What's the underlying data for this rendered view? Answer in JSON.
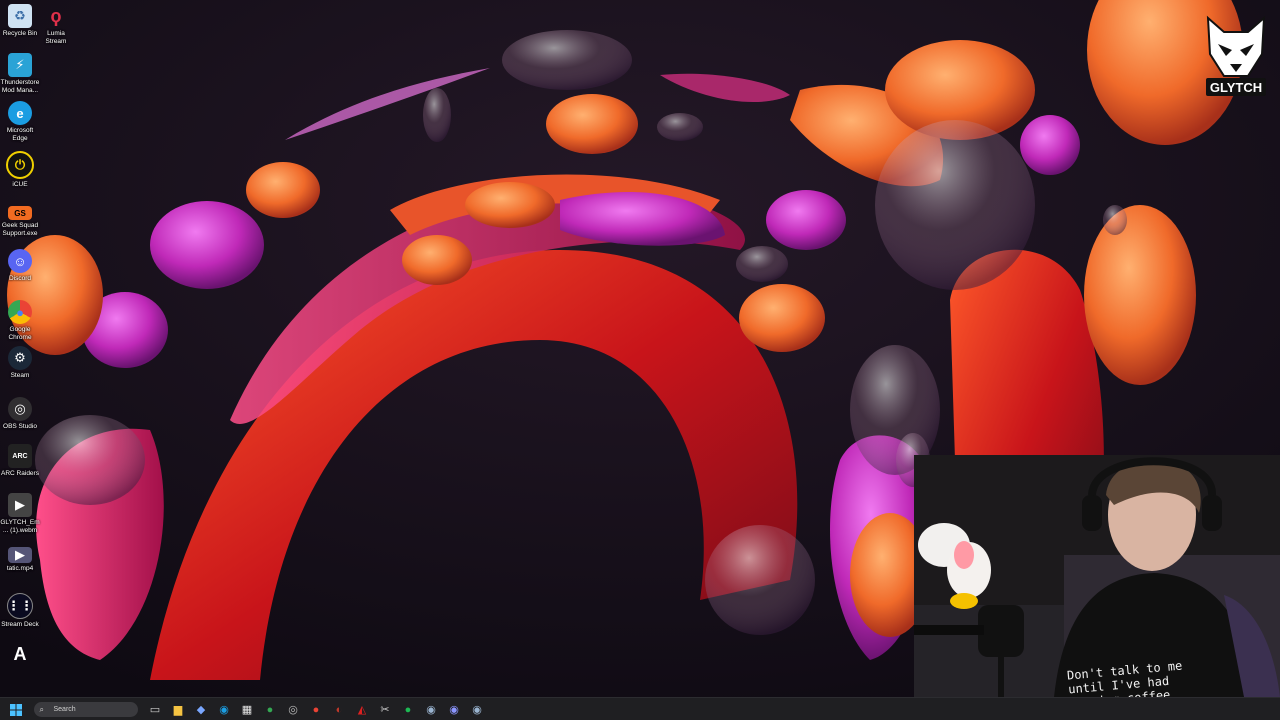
{
  "desktop": {
    "icons": [
      {
        "label": "Recycle Bin",
        "icon": "recycle-bin-icon",
        "color": "#6fa8dc"
      },
      {
        "label": "Lumia Stream",
        "icon": "lumia-stream-icon",
        "color": "#e0304a"
      },
      {
        "label": "Thunderstore Mod Mana...",
        "icon": "thunderstore-icon",
        "color": "#2aa3d6"
      },
      {
        "label": "Microsoft Edge",
        "icon": "edge-icon",
        "color": "#1b9de2"
      },
      {
        "label": "iCUE",
        "icon": "icue-icon",
        "color": "#f0d000"
      },
      {
        "label": "Geek Squad Support.exe",
        "icon": "geek-squad-icon",
        "color": "#f26b21"
      },
      {
        "label": "Discord",
        "icon": "discord-icon",
        "color": "#5865f2"
      },
      {
        "label": "Google Chrome",
        "icon": "chrome-icon",
        "color": "#34a853"
      },
      {
        "label": "Steam",
        "icon": "steam-icon",
        "color": "#1b2838"
      },
      {
        "label": "OBS Studio",
        "icon": "obs-icon",
        "color": "#302e31"
      },
      {
        "label": "ARC Raiders",
        "icon": "arc-raiders-icon",
        "color": "#222222"
      },
      {
        "label": "GLYTCH_Em... (1).webm",
        "icon": "video-file-icon",
        "color": "#444444"
      },
      {
        "label": "tatic.mp4",
        "icon": "video-file-icon",
        "color": "#555577"
      },
      {
        "label": "Stream Deck",
        "icon": "stream-deck-icon",
        "color": "#0a0a20"
      },
      {
        "label": "Adobe",
        "icon": "adobe-icon",
        "color": "#ffffff"
      }
    ]
  },
  "taskbar": {
    "search_placeholder": "Search",
    "start_icon": "windows-start-icon",
    "apps": [
      {
        "name": "task-view",
        "glyph": "▭",
        "color": "#cfcfcf"
      },
      {
        "name": "file-explorer",
        "glyph": "▆",
        "color": "#f5c342"
      },
      {
        "name": "copilot",
        "glyph": "◆",
        "color": "#7aa7ff"
      },
      {
        "name": "edge",
        "glyph": "◉",
        "color": "#1b9de2"
      },
      {
        "name": "store",
        "glyph": "▦",
        "color": "#e8e8e8"
      },
      {
        "name": "chrome",
        "glyph": "●",
        "color": "#34a853"
      },
      {
        "name": "obs",
        "glyph": "◎",
        "color": "#bbbbbb"
      },
      {
        "name": "chrome-alt",
        "glyph": "●",
        "color": "#ea4335"
      },
      {
        "name": "game-app",
        "glyph": "◐",
        "color": "#c0392b"
      },
      {
        "name": "amd-software",
        "glyph": "◭",
        "color": "#e02020"
      },
      {
        "name": "snipping",
        "glyph": "✂",
        "color": "#d0d0d0"
      },
      {
        "name": "spotify",
        "glyph": "●",
        "color": "#1db954"
      },
      {
        "name": "steam",
        "glyph": "◉",
        "color": "#9ab4d0"
      },
      {
        "name": "discord",
        "glyph": "◉",
        "color": "#8c96ff"
      },
      {
        "name": "steam-alt",
        "glyph": "◉",
        "color": "#9ab4d0"
      }
    ]
  },
  "overlay": {
    "logo_text": "GLYTCH",
    "shirt_text": "Don't talk to me\nuntil I've had\n#!@%ing coffee"
  }
}
